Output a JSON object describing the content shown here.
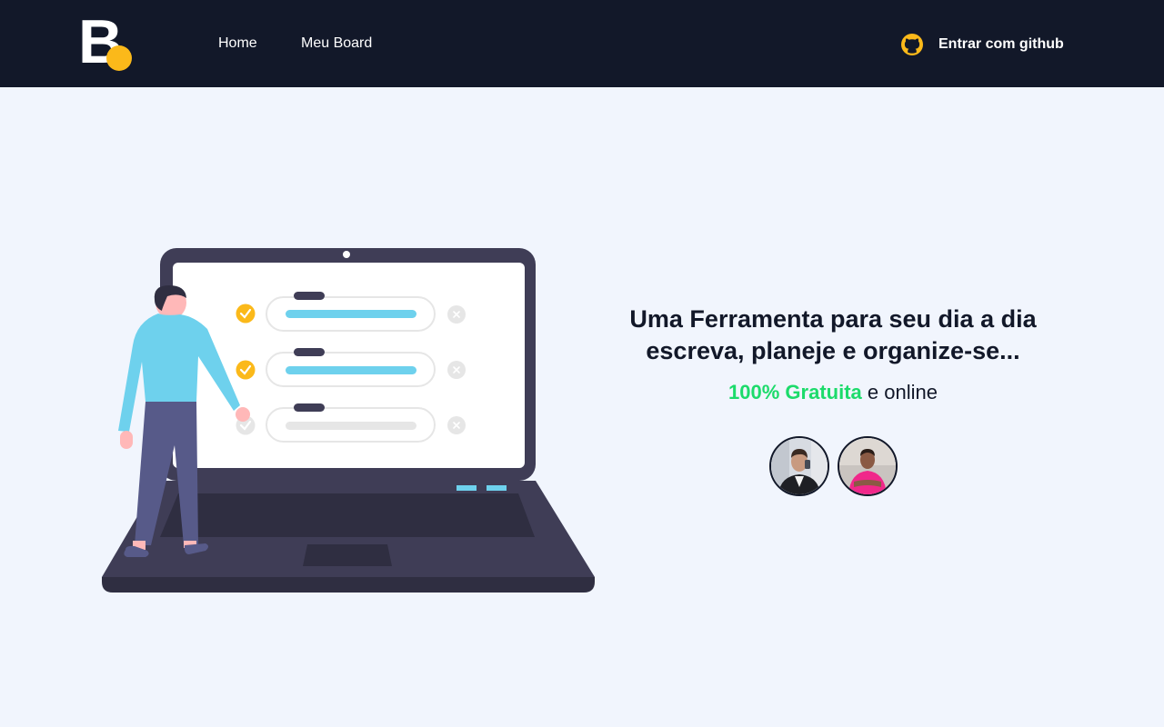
{
  "header": {
    "logo_letter": "B",
    "nav": [
      {
        "label": "Home"
      },
      {
        "label": "Meu Board"
      }
    ],
    "login_label": "Entrar com github",
    "login_icon": "github-icon"
  },
  "hero": {
    "headline_line1": "Uma Ferramenta para seu dia a dia",
    "headline_line2": "escreva, planeje e organize-se...",
    "highlight": "100% Gratuita",
    "subline_rest": "e online"
  },
  "colors": {
    "header_bg": "#121829",
    "page_bg": "#f1f5fd",
    "accent_yellow": "#fbb91a",
    "accent_green": "#1cdb6b"
  }
}
